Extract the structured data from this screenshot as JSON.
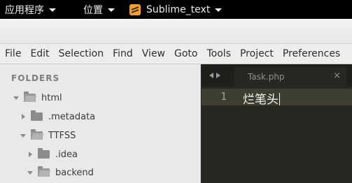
{
  "topbar": {
    "applications_label": "应用程序",
    "places_label": "位置",
    "active_app_label": "Sublime_text",
    "active_app_icon": "sublime-text-icon"
  },
  "menubar": {
    "items": [
      "File",
      "Edit",
      "Selection",
      "Find",
      "View",
      "Goto",
      "Tools",
      "Project",
      "Preferences"
    ]
  },
  "sidebar": {
    "header": "FOLDERS",
    "tree": [
      {
        "label": "html",
        "state": "open"
      },
      {
        "label": ".metadata",
        "state": "closed"
      },
      {
        "label": "TTFSS",
        "state": "open"
      },
      {
        "label": ".idea",
        "state": "closed"
      },
      {
        "label": "backend",
        "state": "open"
      }
    ]
  },
  "editor": {
    "tab_title": "Task.php",
    "tab_close": "×",
    "line_number": "1",
    "line_text": "烂笔头"
  },
  "colors": {
    "editor_bg": "#272822",
    "current_line_bg": "#3e3d32",
    "sublime_orange": "#f29f2b"
  }
}
